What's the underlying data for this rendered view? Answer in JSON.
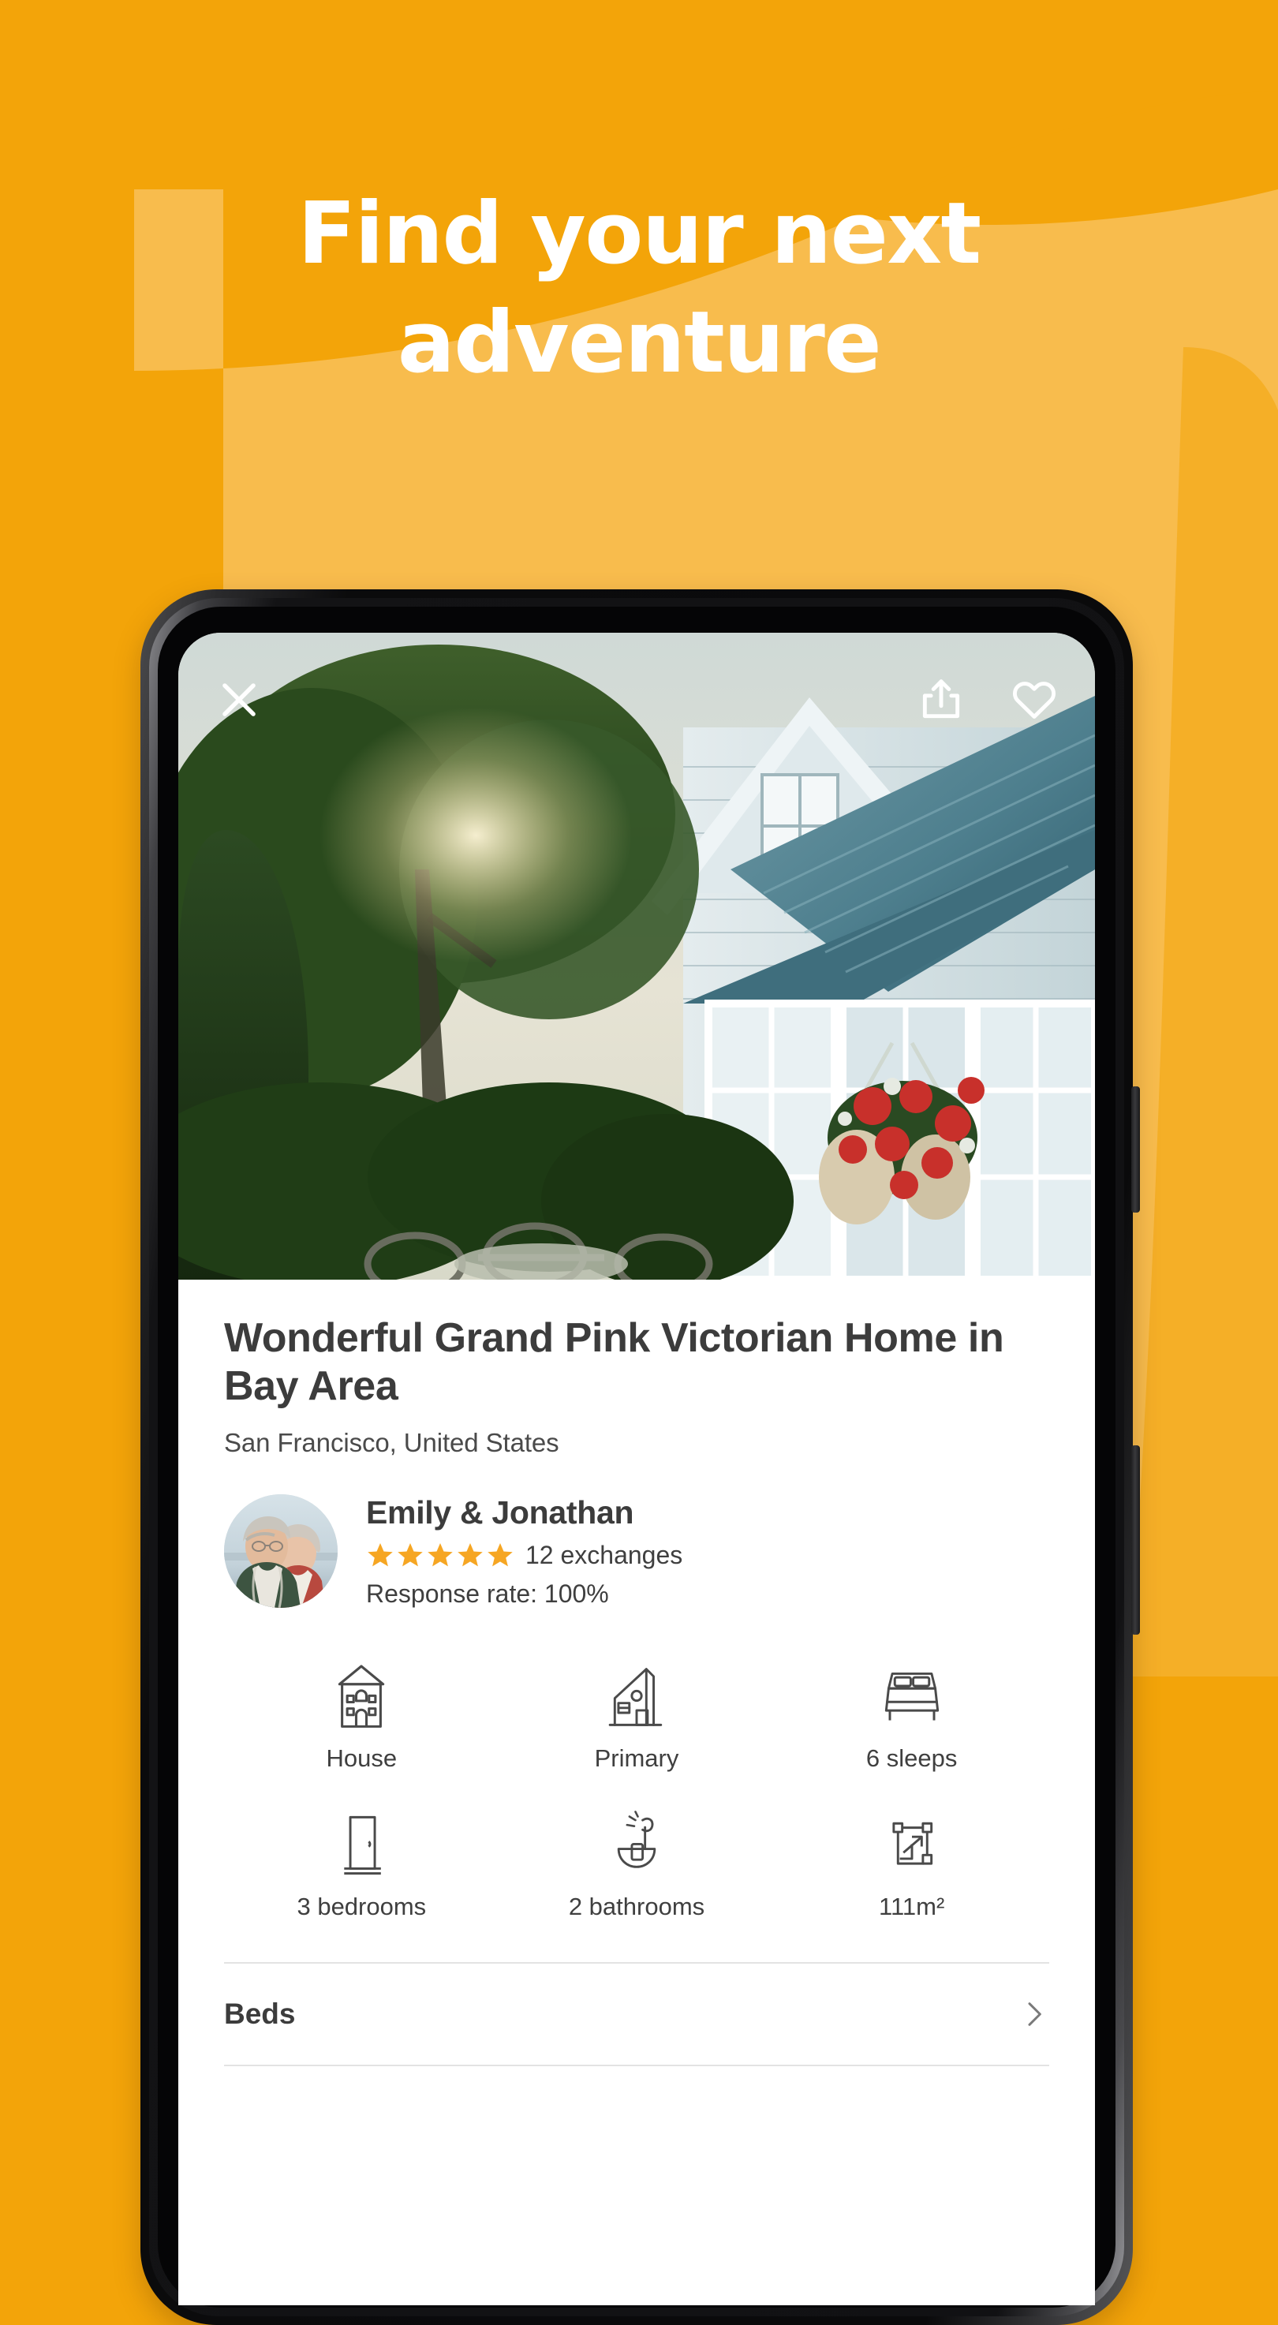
{
  "page": {
    "background_color": "#F3A409",
    "background_accent_color": "#F8BC4D"
  },
  "headline": {
    "line1": "Find your next",
    "line2": "adventure",
    "color": "#FFFFFF"
  },
  "phone": {
    "hero": {
      "icons": {
        "close": "close-icon",
        "share": "share-icon",
        "favorite": "heart-icon"
      }
    },
    "listing": {
      "title": "Wonderful Grand Pink Victorian Home in Bay Area",
      "location": "San Francisco, United States"
    },
    "host": {
      "name": "Emily & Jonathan",
      "stars": 5,
      "star_color": "#F6A623",
      "exchanges": "12 exchanges",
      "response_rate": "Response rate: 100%",
      "avatar": "host-avatar"
    },
    "features": [
      {
        "icon": "house-icon",
        "label": "House"
      },
      {
        "icon": "primary-home-icon",
        "label": "Primary"
      },
      {
        "icon": "bed-icon",
        "label": "6 sleeps"
      },
      {
        "icon": "door-icon",
        "label": "3 bedrooms"
      },
      {
        "icon": "shower-icon",
        "label": "2 bathrooms"
      },
      {
        "icon": "area-icon",
        "label": "111m²"
      }
    ],
    "sections": [
      {
        "label": "Beds",
        "chevron": "chevron-right-icon"
      }
    ]
  }
}
